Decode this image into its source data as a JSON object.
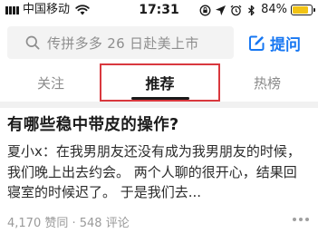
{
  "status_bar": {
    "carrier": "中国移动",
    "time": "17:31",
    "battery_percent": "84%",
    "battery_level": 0.84,
    "icons": [
      "signal-icon",
      "wifi-icon",
      "lock-rotation-icon",
      "location-icon",
      "alarm-icon",
      "bluetooth-icon",
      "battery-icon"
    ],
    "battery_color": "#f2c314"
  },
  "search": {
    "placeholder": "传拼多多 26 日赴美上市",
    "icon": "search-icon"
  },
  "ask": {
    "label": "提问",
    "icon": "edit-icon",
    "color": "#1777f2"
  },
  "tabs": [
    {
      "label": "关注",
      "active": false
    },
    {
      "label": "推荐",
      "active": true
    },
    {
      "label": "热榜",
      "active": false
    }
  ],
  "highlight_color": "#d9383e",
  "feed": [
    {
      "title": "有哪些稳中带皮的操作?",
      "excerpt": "夏小x：在我男朋友还没有成为我男朋友的时候，我们晚上出去约会。 两个人聊的很开心，结果回寝室的时候迟了。 于是我们去...",
      "meta": "4,170 赞同 · 548 评论",
      "more_icon": "more-icon"
    }
  ]
}
